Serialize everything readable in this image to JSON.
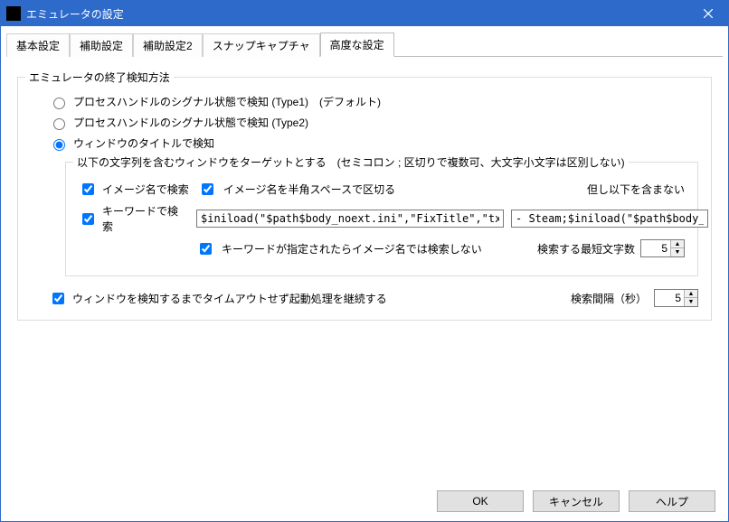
{
  "window": {
    "title": "エミュレータの設定"
  },
  "tabs": [
    {
      "label": "基本設定",
      "active": false
    },
    {
      "label": "補助設定",
      "active": false
    },
    {
      "label": "補助設定2",
      "active": false
    },
    {
      "label": "スナップキャプチャ",
      "active": false
    },
    {
      "label": "高度な設定",
      "active": true
    }
  ],
  "detection": {
    "legend": "エミュレータの終了検知方法",
    "radio_type1": "プロセスハンドルのシグナル状態で検知 (Type1)　(デフォルト)",
    "radio_type2": "プロセスハンドルのシグナル状態で検知 (Type2)",
    "radio_title": "ウィンドウのタイトルで検知",
    "sub": {
      "legend": "以下の文字列を含むウィンドウをターゲットとする　(セミコロン ; 区切りで複数可、大文字小文字は区別しない)",
      "cb_image_name": "イメージ名で検索",
      "cb_image_space": "イメージ名を半角スペースで区切る",
      "exclude_label": "但し以下を含まない",
      "cb_keyword": "キーワードで検索",
      "keyword_value": "$iniload(\"$path$body_noext.ini\",\"FixTitle\",\"txt\")",
      "exclude_value": "- Steam;$iniload(\"$path$body_noext.ini\",",
      "cb_keyword_only": "キーワードが指定されたらイメージ名では検索しない",
      "min_len_label": "検索する最短文字数",
      "min_len_value": "5"
    },
    "cb_continue": "ウィンドウを検知するまでタイムアウトせず起動処理を継続する",
    "interval_label": "検索間隔（秒）",
    "interval_value": "5"
  },
  "buttons": {
    "ok": "OK",
    "cancel": "キャンセル",
    "help": "ヘルプ"
  }
}
